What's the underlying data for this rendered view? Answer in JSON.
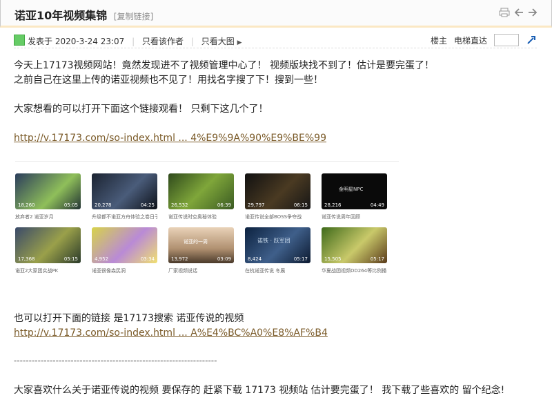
{
  "header": {
    "title": "诺亚10年视频集锦",
    "copy_link": "[复制链接]"
  },
  "post": {
    "posted_at": "发表于 2020-3-24 23:07",
    "only_author": "只看该作者",
    "only_images": "只看大图",
    "owner": "楼主",
    "floor_jump": "电梯直达"
  },
  "content": {
    "p1": "今天上17173视频网站！竟然发现进不了视频管理中心了！ 视频版块找不到了！估计是要完蛋了！",
    "p2": "之前自己在这里上传的诺亚视频也不见了！用找名字搜了下！搜到一些！",
    "p3": "大家想看的可以打开下面这个链接观看！ 只剩下这几个了！",
    "link1": "http://v.17173.com/so-index.html ... 4%E9%9A%90%E9%BE%99",
    "p4": "也可以打开下面的链接  是17173搜索 诺亚传说的视频",
    "link2": "http://v.17173.com/so-index.html ... A%E4%BC%A0%E8%AF%B4",
    "divider": "--------------------------------------------------------------------",
    "p5": "大家喜欢什么关于诺亚传说的视频 要保存的 赶紧下载 17173 视频站 估计要完蛋了！ 我下载了些喜欢的 留个纪念!"
  },
  "videos": [
    {
      "views": "18,260",
      "duration": "05:05",
      "title": "放弃者2 诺亚岁月"
    },
    {
      "views": "20,278",
      "duration": "04:25",
      "title": "升级都不诺亚方舟体验之卷日子"
    },
    {
      "views": "26,532",
      "duration": "06:39",
      "title": "诺亚传说时空奥秘体验"
    },
    {
      "views": "29,797",
      "duration": "06:15",
      "title": "诺亚传说全部BOSS争夺战"
    },
    {
      "views": "28,216",
      "duration": "04:49",
      "title": "诺亚传说周年回顾",
      "overlay": "金明星NPC"
    },
    {
      "views": "17,368",
      "duration": "05:15",
      "title": "诺亚2大家团实战PK"
    },
    {
      "views": "4,952",
      "duration": "03:34",
      "title": "诺亚很像森民洞"
    },
    {
      "views": "13,972",
      "duration": "03:09",
      "title": "厂家视频说话",
      "overlay": "诺亚的一周"
    },
    {
      "views": "8,424",
      "duration": "05:17",
      "title": "在杭诺亚传说 冬展",
      "overlay": "诺铁 · 跃军团"
    },
    {
      "views": "15,505",
      "duration": "05:17",
      "title": "华夏战团视频DD264等比例播..."
    }
  ]
}
